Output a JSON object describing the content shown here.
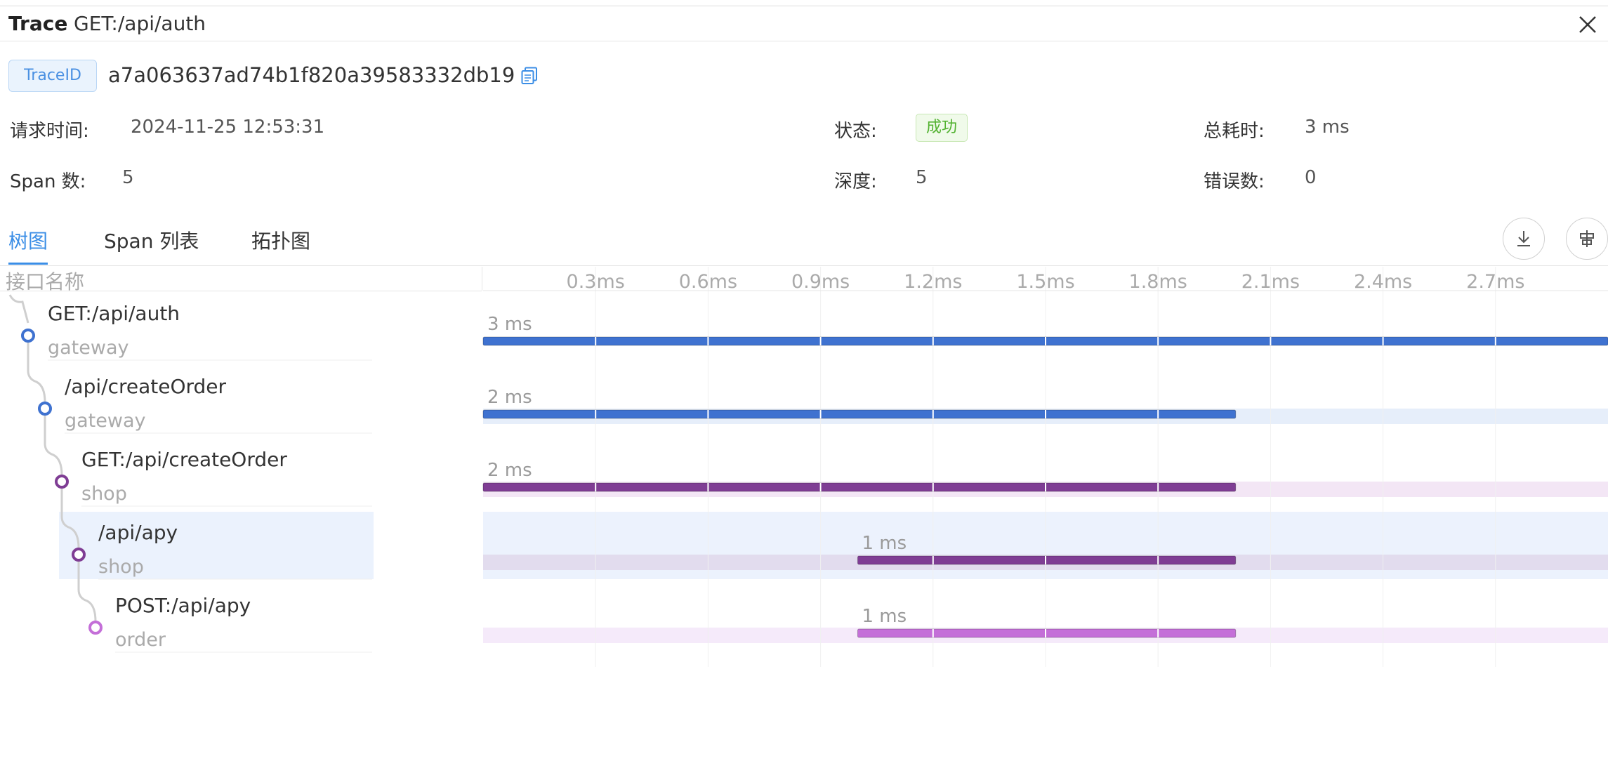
{
  "header": {
    "title": "Trace",
    "name": "GET:/api/auth"
  },
  "trace": {
    "id_label": "TraceID",
    "id_value": "a7a063637ad74b1f820a39583332db19"
  },
  "info": {
    "request_time_label": "请求时间:",
    "request_time": "2024-11-25 12:53:31",
    "status_label": "状态:",
    "status": "成功",
    "duration_label": "总耗时:",
    "duration": "3 ms",
    "span_count_label": "Span 数:",
    "span_count": "5",
    "depth_label": "深度:",
    "depth": "5",
    "errors_label": "错误数:",
    "errors": "0"
  },
  "tabs": [
    "树图",
    "Span 列表",
    "拓扑图"
  ],
  "column_header": "接口名称",
  "ticks": [
    "0.3ms",
    "0.6ms",
    "0.9ms",
    "1.2ms",
    "1.5ms",
    "1.8ms",
    "2.1ms",
    "2.4ms",
    "2.7ms"
  ],
  "spans": [
    {
      "name": "GET:/api/auth",
      "service": "gateway",
      "label": "3 ms",
      "start": 0,
      "end": 1.0,
      "color": "#3f72d0",
      "dot": "#3f72d0",
      "bg": "#ffffff"
    },
    {
      "name": "/api/createOrder",
      "service": "gateway",
      "label": "2 ms",
      "start": 0,
      "end": 0.669,
      "color": "#3f72d0",
      "dot": "#3f72d0",
      "bg": "#e6eefa"
    },
    {
      "name": "GET:/api/createOrder",
      "service": "shop",
      "label": "2 ms",
      "start": 0,
      "end": 0.669,
      "color": "#7f3d94",
      "dot": "#7f3d94",
      "bg": "#f3e6f5"
    },
    {
      "name": "/api/apy",
      "service": "shop",
      "label": "1 ms",
      "start": 0.333,
      "end": 0.669,
      "color": "#7f3d94",
      "dot": "#7f3d94",
      "bg": "#e2dcee",
      "selected": true
    },
    {
      "name": "POST:/api/apy",
      "service": "order",
      "label": "1 ms",
      "start": 0.333,
      "end": 0.669,
      "color": "#c46fd8",
      "dot": "#c46fd8",
      "bg": "#f5eafa"
    }
  ],
  "colors": {
    "accent": "#3b8ee6",
    "success": "#52b230"
  }
}
